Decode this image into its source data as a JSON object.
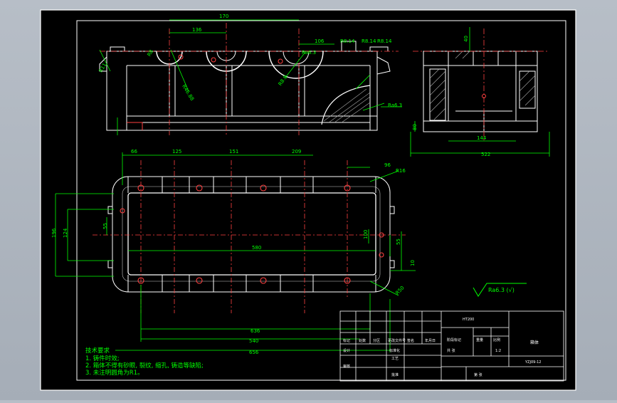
{
  "drawing": {
    "top_dims": [
      "170",
      "136",
      "106",
      "R8.14",
      "R8.14",
      "R8.14",
      "R8",
      "R11",
      "R46.88",
      "R8.9"
    ],
    "roughness_labels": [
      "Ra6.3",
      "Ra6.3",
      "Ra6.3 (√)"
    ],
    "side_dims": [
      "40",
      "80",
      "144",
      "522"
    ],
    "plan_top_dims": [
      "66",
      "125",
      "151",
      "209",
      "96"
    ],
    "plan_left_dims": [
      "196",
      "124",
      "55"
    ],
    "plan_center_dim": "580",
    "plan_right_dims": [
      "R16",
      "100",
      "55",
      "10",
      "R50"
    ],
    "plan_bottom_dims": [
      "636",
      "540",
      "656"
    ],
    "notes": {
      "title": "技术要求",
      "lines": [
        "1. 铸件时效;",
        "2. 箱体不得有砂眼, 裂纹, 缩孔, 铸造等缺陷;",
        "3. 未注明圆角为R1。"
      ]
    },
    "title_block": {
      "drawing_name": "箱体",
      "material": "HT200",
      "scale": "1:2",
      "drawing_no": "YZJ09-12",
      "row_labels": [
        "标记",
        "处数",
        "分区",
        "更改文件号",
        "签名",
        "年月日"
      ],
      "left_labels": [
        "设计",
        "审核",
        "工艺",
        "标准化",
        "批准"
      ],
      "mid_labels": [
        "阶段标记",
        "重量",
        "比例"
      ],
      "small_labels": [
        "共 张",
        "第 张"
      ]
    }
  },
  "colors": {
    "background": "#000000",
    "outline": "#ffffff",
    "dimension": "#00ff00",
    "centerline": "#ff0000",
    "hole": "#ff4040",
    "text": "#00ff00"
  }
}
